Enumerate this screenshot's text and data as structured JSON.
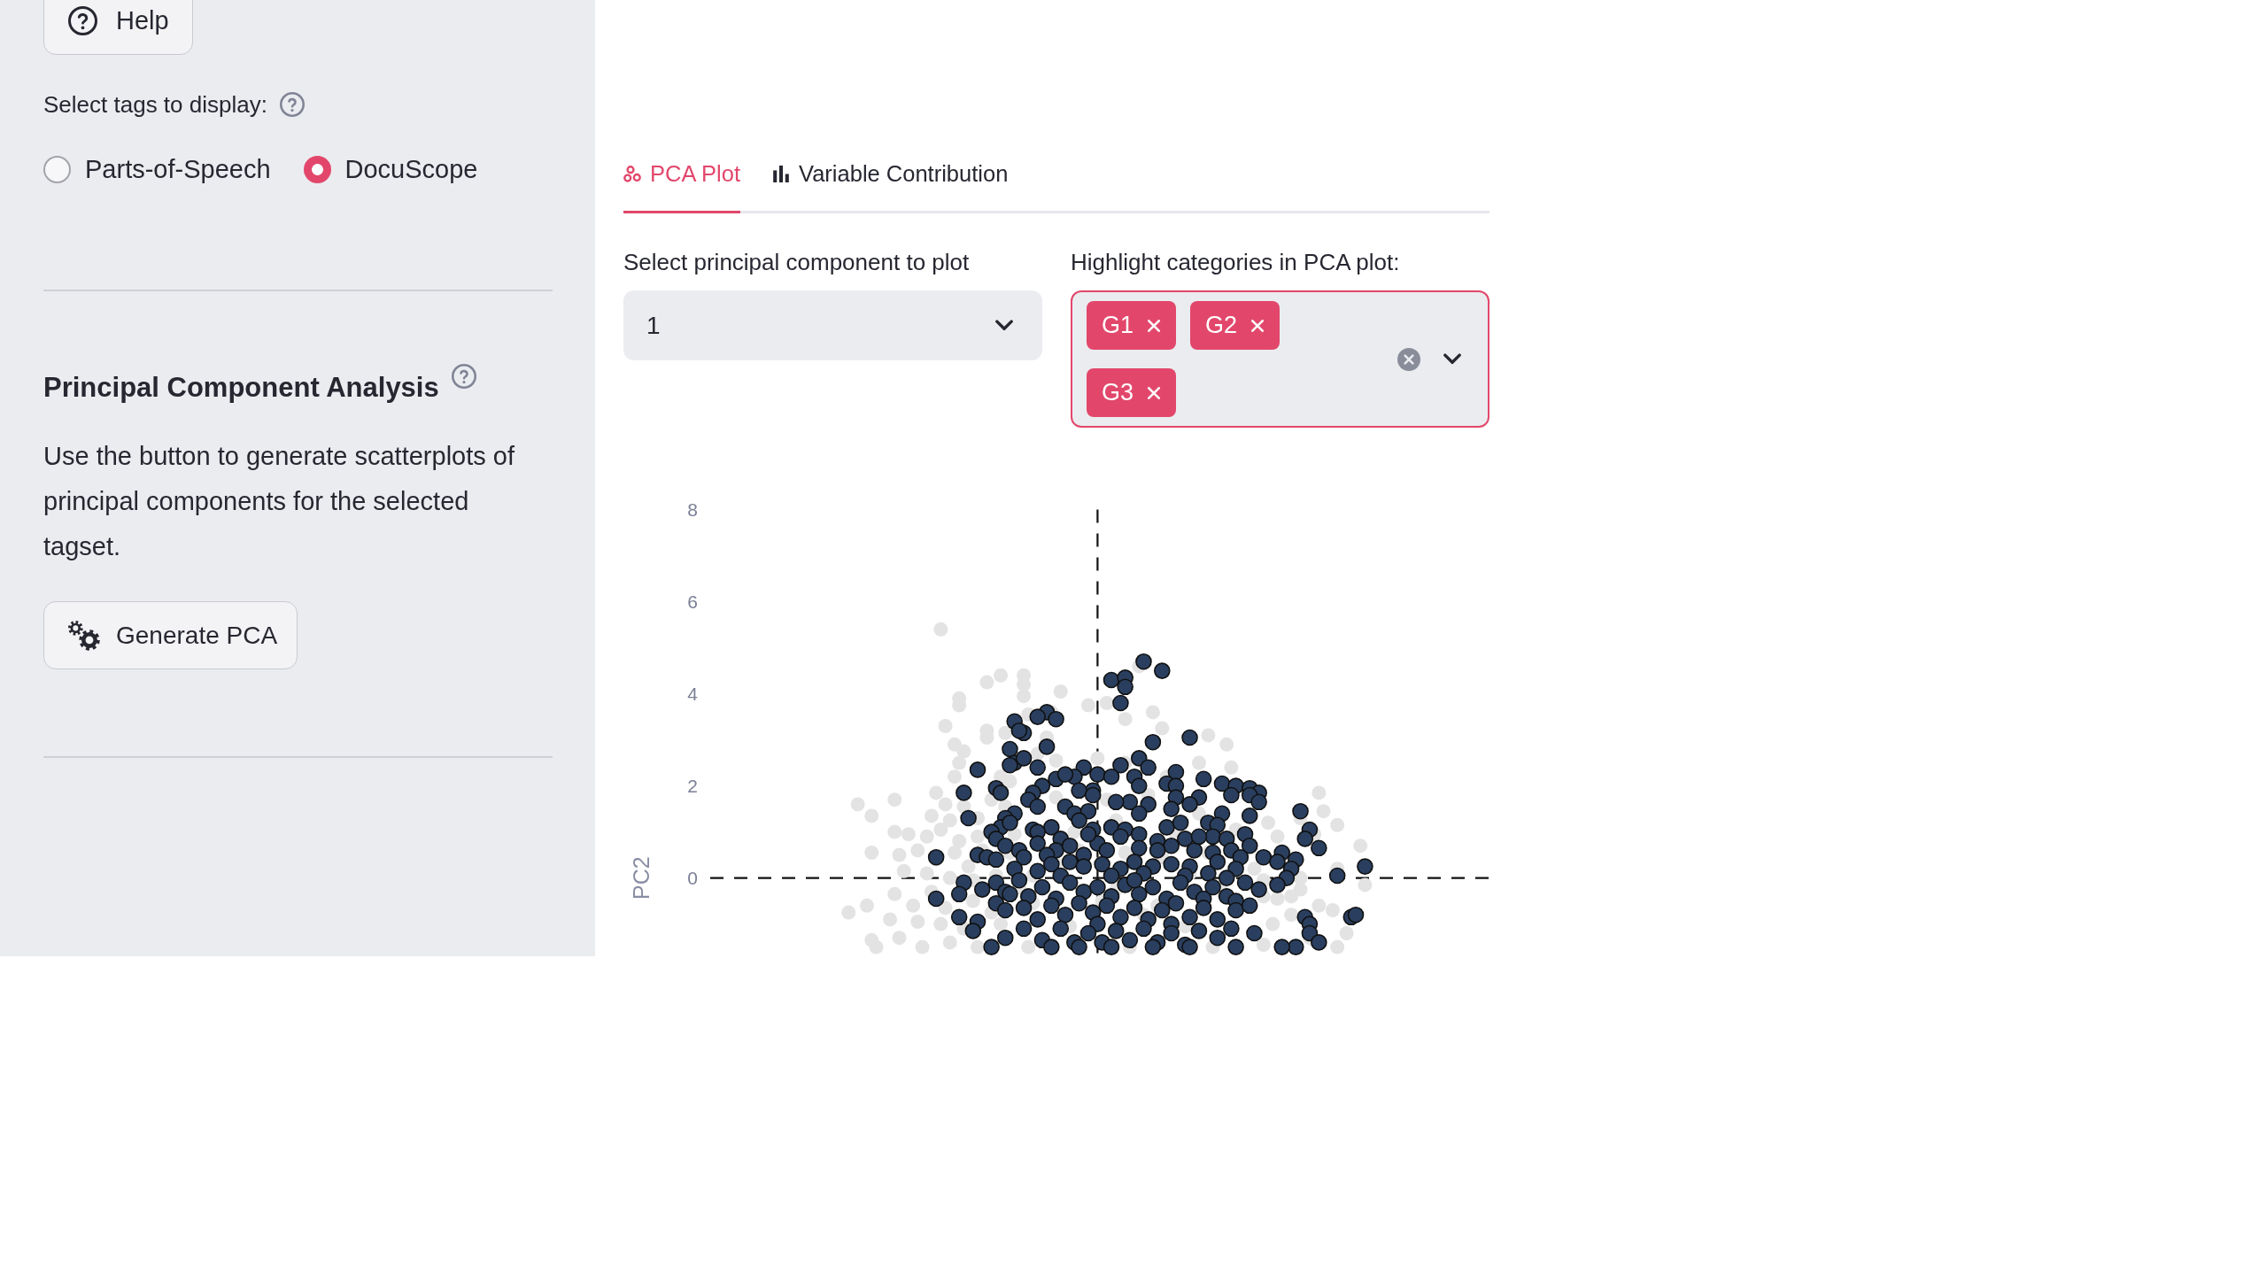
{
  "sidebar": {
    "help_button": {
      "label": "Help"
    },
    "tagset": {
      "label": "Select tags to display:",
      "options": [
        {
          "label": "Parts-of-Speech",
          "selected": false
        },
        {
          "label": "DocuScope",
          "selected": true
        }
      ]
    },
    "pca_section": {
      "title": "Principal Component Analysis",
      "description": "Use the button to generate scatterplots of principal components for the selected tagset.",
      "button": {
        "label": "Generate PCA"
      }
    }
  },
  "tabs": [
    {
      "label": "PCA Plot",
      "selected": true
    },
    {
      "label": "Variable Contribution",
      "selected": false
    }
  ],
  "component_select": {
    "label": "Select principal component to plot",
    "value": "1"
  },
  "category_select": {
    "label": "Highlight categories in PCA plot:",
    "focused": true,
    "tags": [
      "G1",
      "G2",
      "G3"
    ]
  },
  "pca_plot": {
    "y_axis_title": "PC2",
    "y_tick_labels": [
      "8",
      "6",
      "4",
      "2",
      "0"
    ]
  }
}
